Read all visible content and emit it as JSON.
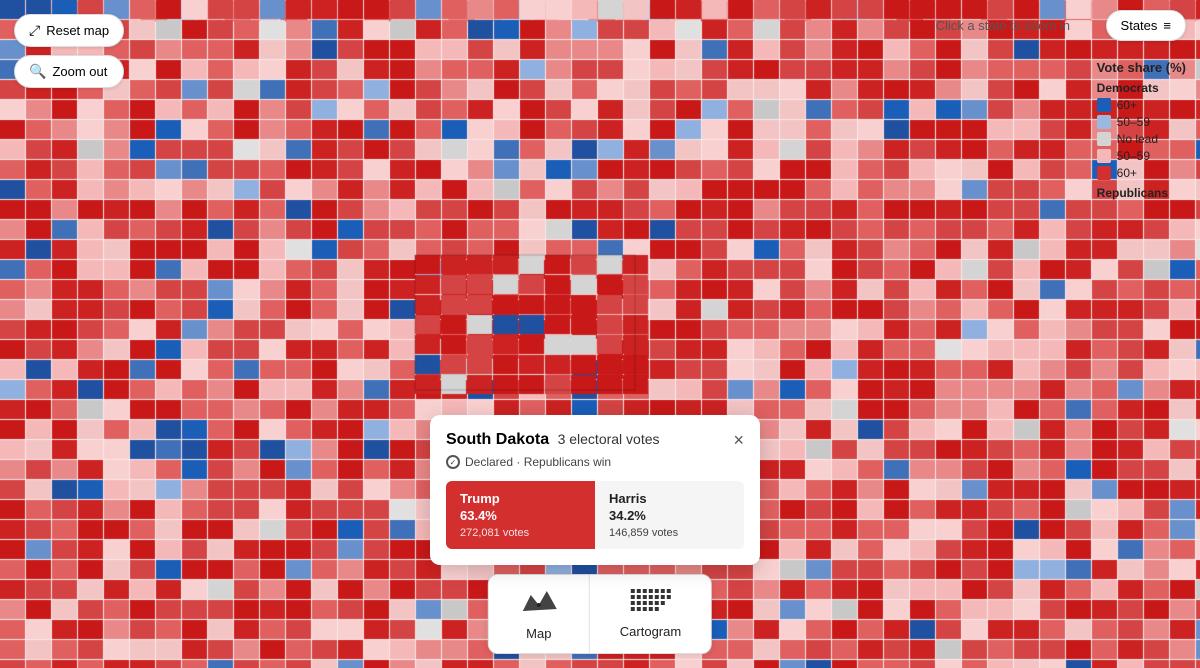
{
  "controls": {
    "reset_map_label": "Reset map",
    "zoom_out_label": "Zoom out",
    "states_label": "States",
    "click_hint": "Click a state to zoom in"
  },
  "legend": {
    "title": "Vote share (%)",
    "democrats_label": "Democrats",
    "republicans_label": "Republicans",
    "items_dem": [
      {
        "label": "60+",
        "color": "#1a5eb8"
      },
      {
        "label": "50–59",
        "color": "#9bb8e0"
      },
      {
        "label": "No lead",
        "color": "#d4d4d4"
      }
    ],
    "items_rep": [
      {
        "label": "50–59",
        "color": "#f5b8b8"
      },
      {
        "label": "60+",
        "color": "#d32f2f"
      }
    ]
  },
  "popup": {
    "state": "South Dakota",
    "electoral_votes": "3 electoral votes",
    "declared_text": "Declared · Republicans win",
    "trump_name": "Trump",
    "trump_pct": "63.4%",
    "trump_votes": "272,081 votes",
    "harris_name": "Harris",
    "harris_pct": "34.2%",
    "harris_votes": "146,859 votes",
    "close_label": "×"
  },
  "map_selector": {
    "map_label": "Map",
    "cartogram_label": "Cartogram"
  }
}
